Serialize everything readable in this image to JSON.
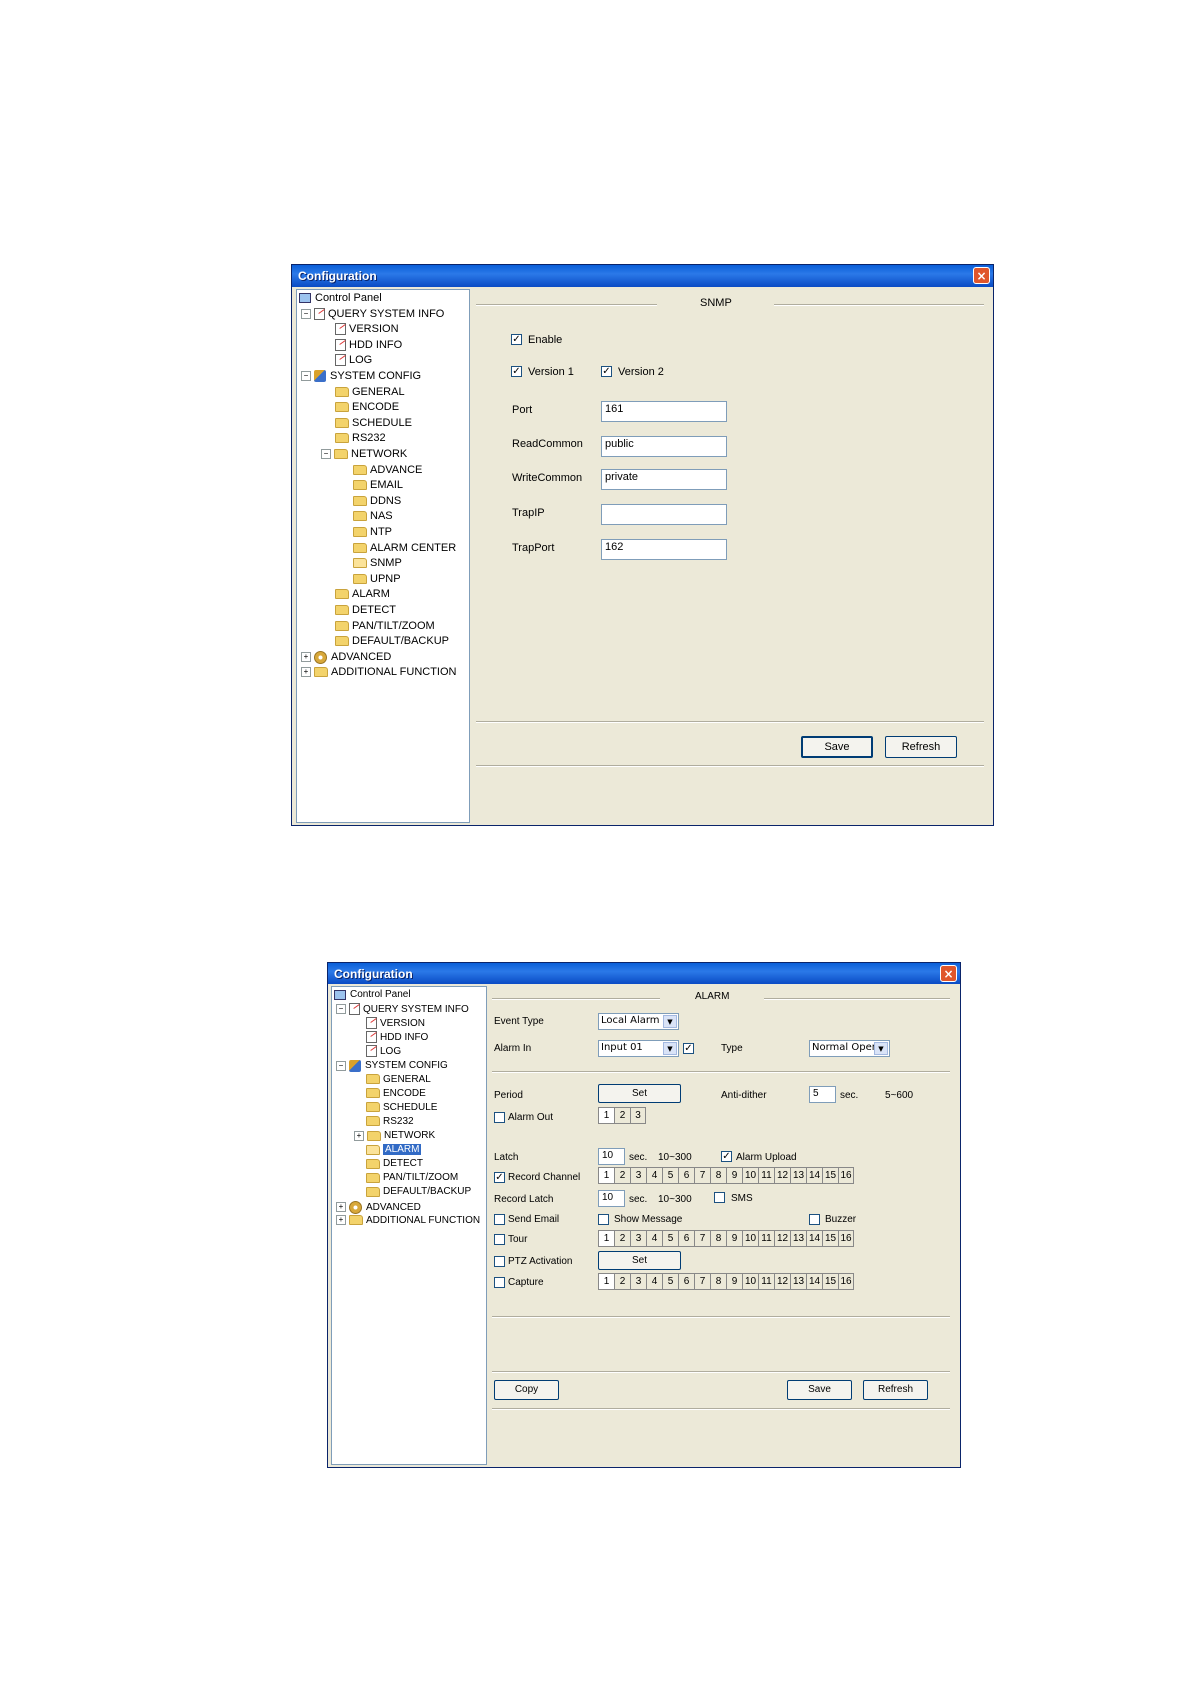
{
  "window1": {
    "title": "Configuration",
    "close": "×",
    "tree": [
      {
        "label": "Control Panel",
        "icon": "computer-icon"
      },
      {
        "label": "QUERY SYSTEM INFO",
        "icon": "note-icon"
      },
      {
        "label": "VERSION",
        "icon": "note-icon"
      },
      {
        "label": "HDD INFO",
        "icon": "note-icon"
      },
      {
        "label": "LOG",
        "icon": "note-icon"
      },
      {
        "label": "SYSTEM CONFIG",
        "icon": "tools-icon"
      },
      {
        "label": "GENERAL",
        "icon": "folder-icon"
      },
      {
        "label": "ENCODE",
        "icon": "folder-icon"
      },
      {
        "label": "SCHEDULE",
        "icon": "folder-icon"
      },
      {
        "label": "RS232",
        "icon": "folder-icon"
      },
      {
        "label": "NETWORK",
        "icon": "folder-icon"
      },
      {
        "label": "ADVANCE",
        "icon": "folder-icon"
      },
      {
        "label": "EMAIL",
        "icon": "folder-icon"
      },
      {
        "label": "DDNS",
        "icon": "folder-icon"
      },
      {
        "label": "NAS",
        "icon": "folder-icon"
      },
      {
        "label": "NTP",
        "icon": "folder-icon"
      },
      {
        "label": "ALARM CENTER",
        "icon": "folder-icon"
      },
      {
        "label": "SNMP",
        "icon": "folder-open-icon"
      },
      {
        "label": "UPNP",
        "icon": "folder-icon"
      },
      {
        "label": "ALARM",
        "icon": "folder-icon"
      },
      {
        "label": "DETECT",
        "icon": "folder-icon"
      },
      {
        "label": "PAN/TILT/ZOOM",
        "icon": "folder-icon"
      },
      {
        "label": "DEFAULT/BACKUP",
        "icon": "folder-icon"
      },
      {
        "label": "ADVANCED",
        "icon": "gear-icon"
      },
      {
        "label": "ADDITIONAL FUNCTION",
        "icon": "folder-icon"
      }
    ],
    "section_title": "SNMP",
    "enable_label": "Enable",
    "enable_checked": true,
    "version1_label": "Version 1",
    "version1_checked": true,
    "version2_label": "Version 2",
    "version2_checked": true,
    "port_label": "Port",
    "port_value": "161",
    "readcommon_label": "ReadCommon",
    "readcommon_value": "public",
    "writecommon_label": "WriteCommon",
    "writecommon_value": "private",
    "trapip_label": "TrapIP",
    "trapip_value": "",
    "trapport_label": "TrapPort",
    "trapport_value": "162",
    "save_label": "Save",
    "refresh_label": "Refresh"
  },
  "window2": {
    "title": "Configuration",
    "close": "×",
    "tree": [
      {
        "label": "Control Panel",
        "icon": "computer-icon"
      },
      {
        "label": "QUERY SYSTEM INFO",
        "icon": "note-icon"
      },
      {
        "label": "VERSION",
        "icon": "note-icon"
      },
      {
        "label": "HDD INFO",
        "icon": "note-icon"
      },
      {
        "label": "LOG",
        "icon": "note-icon"
      },
      {
        "label": "SYSTEM CONFIG",
        "icon": "tools-icon"
      },
      {
        "label": "GENERAL",
        "icon": "folder-icon"
      },
      {
        "label": "ENCODE",
        "icon": "folder-icon"
      },
      {
        "label": "SCHEDULE",
        "icon": "folder-icon"
      },
      {
        "label": "RS232",
        "icon": "folder-icon"
      },
      {
        "label": "NETWORK",
        "icon": "folder-icon"
      },
      {
        "label": "ALARM",
        "icon": "folder-open-icon"
      },
      {
        "label": "DETECT",
        "icon": "folder-icon"
      },
      {
        "label": "PAN/TILT/ZOOM",
        "icon": "folder-icon"
      },
      {
        "label": "DEFAULT/BACKUP",
        "icon": "folder-icon"
      },
      {
        "label": "ADVANCED",
        "icon": "gear-icon"
      },
      {
        "label": "ADDITIONAL FUNCTION",
        "icon": "folder-icon"
      }
    ],
    "section_title": "ALARM",
    "event_type_label": "Event Type",
    "event_type_value": "Local Alarm",
    "alarm_in_label": "Alarm In",
    "alarm_in_value": "Input 01",
    "alarm_in_checked": true,
    "type_label": "Type",
    "type_value": "Normal Open",
    "period_label": "Period",
    "set_label": "Set",
    "anti_dither_label": "Anti-dither",
    "anti_dither_value": "5",
    "sec_label": "sec.",
    "anti_dither_range": "5~600",
    "alarm_out_label": "Alarm Out",
    "alarm_out_checked": false,
    "alarm_out_channels": [
      "1",
      "2",
      "3"
    ],
    "latch_label": "Latch",
    "latch_value": "10",
    "latch_range": "10~300",
    "alarm_upload_label": "Alarm Upload",
    "alarm_upload_checked": true,
    "record_channel_label": "Record Channel",
    "record_channel_checked": true,
    "channels": [
      "1",
      "2",
      "3",
      "4",
      "5",
      "6",
      "7",
      "8",
      "9",
      "10",
      "11",
      "12",
      "13",
      "14",
      "15",
      "16"
    ],
    "record_latch_label": "Record Latch",
    "record_latch_value": "10",
    "record_latch_range": "10~300",
    "sms_label": "SMS",
    "sms_checked": false,
    "send_email_label": "Send Email",
    "send_email_checked": false,
    "show_message_label": "Show Message",
    "show_message_checked": false,
    "buzzer_label": "Buzzer",
    "buzzer_checked": false,
    "tour_label": "Tour",
    "tour_checked": false,
    "ptz_label": "PTZ Activation",
    "ptz_checked": false,
    "capture_label": "Capture",
    "capture_checked": false,
    "copy_label": "Copy",
    "save_label": "Save",
    "refresh_label": "Refresh"
  }
}
